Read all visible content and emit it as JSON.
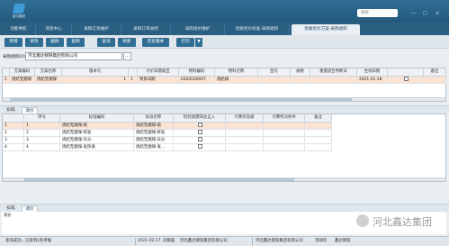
{
  "app": {
    "logo_text": "鑫达集团",
    "search_placeholder": "搜索",
    "window_controls": [
      "—",
      "□",
      "×"
    ]
  },
  "tabs": [
    {
      "label": "功能导航"
    },
    {
      "label": "消息中心"
    },
    {
      "label": "采购订单维护"
    },
    {
      "label": "采购订单关闭"
    },
    {
      "label": "采购询价维护"
    },
    {
      "label": "优质优价标准-采购组织"
    },
    {
      "label": "优质优价方案-采购组织",
      "active": true
    }
  ],
  "toolbar": {
    "buttons": [
      "新增",
      "修改",
      "删除",
      "复制",
      "查询",
      "刷新",
      "历史版本",
      "打印"
    ],
    "print_dropdown": "▼"
  },
  "filter": {
    "org_label": "采购组织(0):",
    "org_value": "河北鑫达钢铁集团有限公司",
    "org_btn": "…"
  },
  "top_grid": {
    "headers": [
      "",
      "方案编码",
      "方案名称",
      "版本号",
      "",
      "计价日期类型",
      "物料编码",
      "物料名称",
      "型号",
      "规格",
      "重量适合判断日",
      "生效日期",
      "",
      "备注"
    ],
    "rows": [
      {
        "n": "1",
        "code": "烧结无烟煤",
        "name": "烧结无烟煤",
        "version": "1",
        "flag": "1",
        "date_type": "到货日期",
        "mat_code": "0302020007",
        "mat_name": "烧结煤",
        "model": "",
        "spec": "",
        "weight": "",
        "eff_date": "2021-01-18",
        "chk": "",
        "remark": ""
      }
    ]
  },
  "mid_tabs": {
    "left": "扣吨",
    "active": "调价"
  },
  "bottom_grid": {
    "headers": [
      "",
      "序号",
      "标准编码",
      "标准名称",
      "检验值需四舍五入",
      "计算优先级",
      "计算判决条件",
      "备注"
    ],
    "rows": [
      {
        "n": "1",
        "seq": "1",
        "code": "烧结无烟煤-硫",
        "name": "烧结无烟煤-硫",
        "round": "",
        "prio": "",
        "cond": "",
        "remark": "",
        "selected": true
      },
      {
        "n": "2",
        "seq": "2",
        "code": "烧结无烟煤-挥发",
        "name": "烧结无烟煤-挥发",
        "round": "",
        "prio": "",
        "cond": "",
        "remark": ""
      },
      {
        "n": "3",
        "seq": "3",
        "code": "烧结无烟煤-灰分",
        "name": "烧结无烟煤-灰分",
        "round": "",
        "prio": "",
        "cond": "",
        "remark": ""
      },
      {
        "n": "4",
        "seq": "4",
        "code": "烧结无烟煤-发热值",
        "name": "烧结无烟煤-发...",
        "round": "",
        "prio": "",
        "cond": "",
        "remark": ""
      }
    ]
  },
  "lower_tabs": {
    "left": "扣吨",
    "active": "调价"
  },
  "lower_sub": "调价",
  "status": {
    "left": "查询成功，已查到1条单据",
    "date": "2021-02-17",
    "user": "刘静霞",
    "org": "河北鑫达钢铁集团有限公司",
    "org2": "河北鑫达钢铁集团有限公司",
    "user2": "李翊华",
    "extra": "鑫达钢铁"
  },
  "watermark": "河北鑫达集团",
  "colors": {
    "header": "#2f6d94",
    "selected_row": "#fbe3d4",
    "tab_active": "#e9eef3"
  }
}
